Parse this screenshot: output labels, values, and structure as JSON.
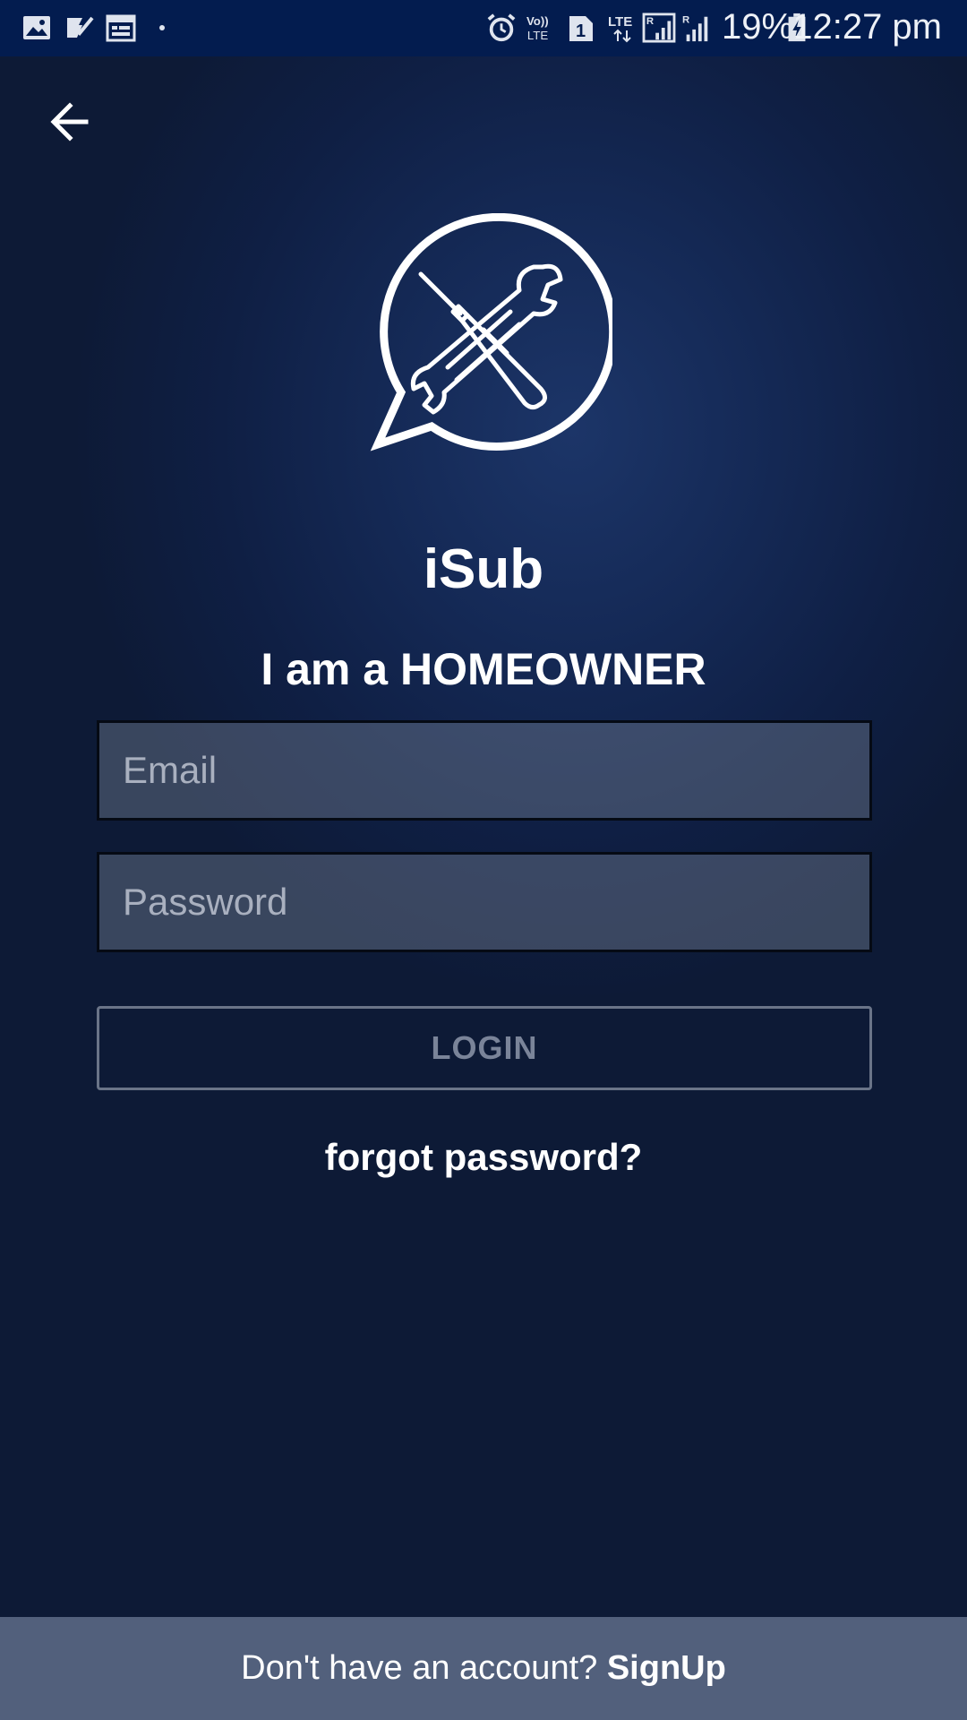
{
  "status_bar": {
    "battery_percent": "19%",
    "time": "12:27 pm",
    "icons": [
      "image-icon",
      "task-check-icon",
      "calendar-icon",
      "dot-icon",
      "alarm-icon",
      "volte-icon",
      "sim-1-icon",
      "lte-data-icon",
      "signal-roaming-icon",
      "signal-icon",
      "battery-charging-icon"
    ],
    "background": "#031c4f"
  },
  "header": {
    "back_icon": "arrow-left-icon"
  },
  "logo": {
    "icon": "tools-chat-bubble-icon"
  },
  "app": {
    "title": "iSub",
    "role_title": "I am a HOMEOWNER"
  },
  "form": {
    "email_placeholder": "Email",
    "email_value": "",
    "password_placeholder": "Password",
    "password_value": "",
    "login_label": "LOGIN",
    "forgot_label": "forgot password?"
  },
  "footer": {
    "prompt": "Don't have an account? ",
    "signup_label": "SignUp",
    "background": "#52607c"
  }
}
